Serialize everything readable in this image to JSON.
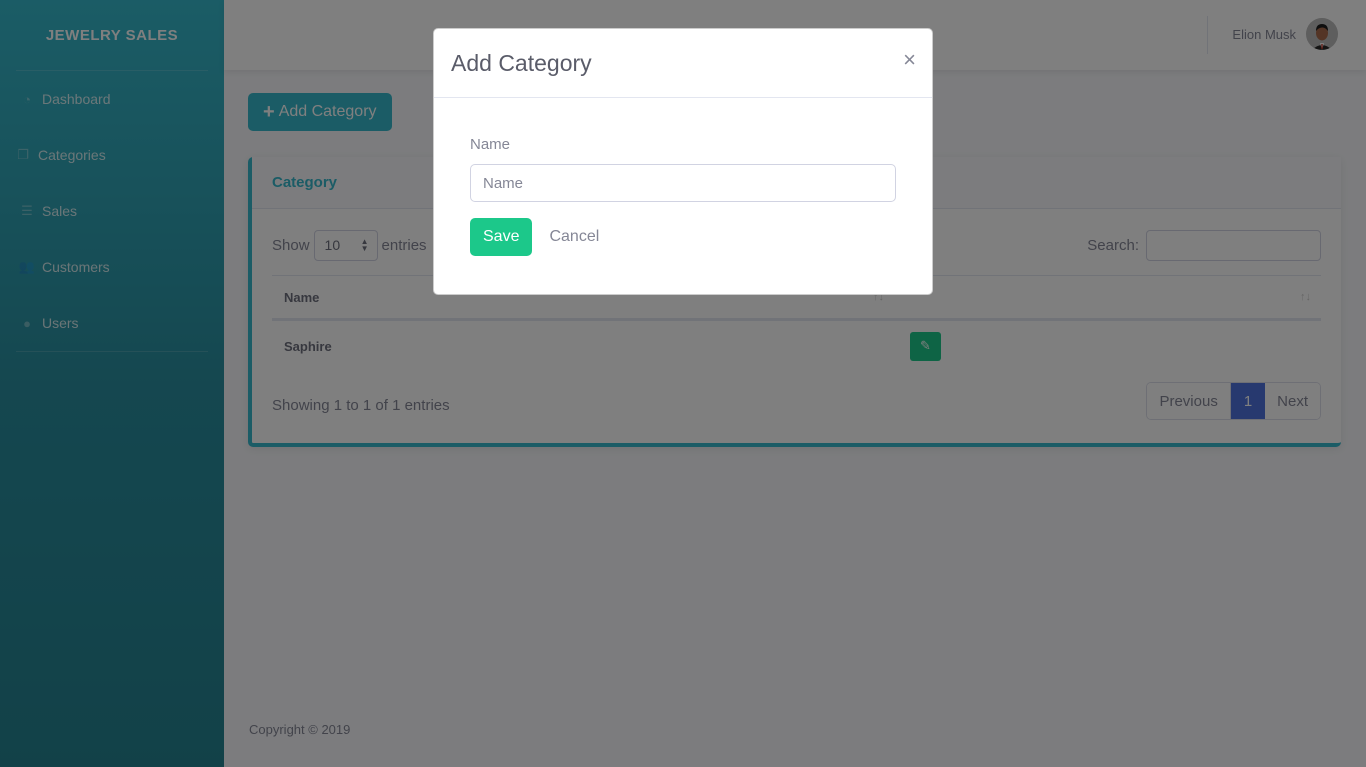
{
  "sidebar": {
    "brand": "JEWELRY SALES",
    "items": [
      {
        "label": "Dashboard",
        "icon": "tachometer-icon"
      },
      {
        "label": "Categories",
        "icon": "copy-icon"
      },
      {
        "label": "Sales",
        "icon": "list-icon"
      },
      {
        "label": "Customers",
        "icon": "users-icon"
      },
      {
        "label": "Users",
        "icon": "user-icon"
      }
    ]
  },
  "topbar": {
    "user_name": "Elion Musk"
  },
  "main": {
    "add_button": "Add Category",
    "card_title": "Category",
    "show_label": "Show",
    "page_length": "10",
    "entries_label": "entries",
    "search_label": "Search:",
    "search_value": "",
    "table": {
      "columns": [
        "Name",
        ""
      ],
      "rows": [
        {
          "name": "Saphire"
        }
      ]
    },
    "info": "Showing 1 to 1 of 1 entries",
    "pagination": {
      "previous": "Previous",
      "current": "1",
      "next": "Next"
    },
    "footer": "Copyright © 2019"
  },
  "modal": {
    "title": "Add Category",
    "close": "×",
    "name_label": "Name",
    "name_placeholder": "Name",
    "name_value": "",
    "save": "Save",
    "cancel": "Cancel"
  },
  "colors": {
    "primary": "#36b9cc",
    "success": "#1cc88a",
    "page_active": "#4e73df"
  }
}
